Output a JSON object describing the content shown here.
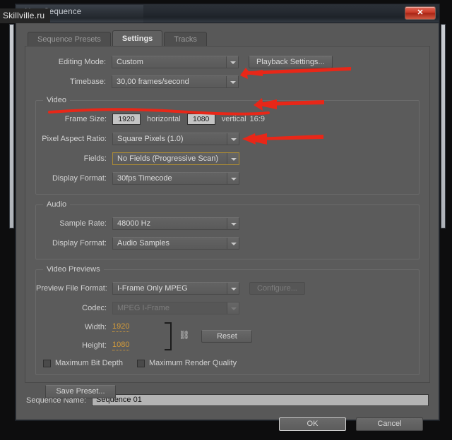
{
  "window": {
    "title": "New Sequence",
    "close_label": "✕"
  },
  "watermark": {
    "text": "Skillville.ru"
  },
  "tabs": [
    {
      "label": "Sequence Presets",
      "active": false
    },
    {
      "label": "Settings",
      "active": true
    },
    {
      "label": "Tracks",
      "active": false
    }
  ],
  "top": {
    "editing_mode_label": "Editing Mode:",
    "editing_mode_value": "Custom",
    "playback_settings_label": "Playback Settings...",
    "timebase_label": "Timebase:",
    "timebase_value": "30,00 frames/second"
  },
  "video": {
    "group_title": "Video",
    "frame_size_label": "Frame Size:",
    "frame_width": "1920",
    "horizontal_label": "horizontal",
    "frame_height": "1080",
    "vertical_label": "vertical",
    "aspect_ratio_text": "16:9",
    "pixel_aspect_label": "Pixel Aspect Ratio:",
    "pixel_aspect_value": "Square Pixels (1.0)",
    "fields_label": "Fields:",
    "fields_value": "No Fields (Progressive Scan)",
    "display_format_label": "Display Format:",
    "display_format_value": "30fps Timecode"
  },
  "audio": {
    "group_title": "Audio",
    "sample_rate_label": "Sample Rate:",
    "sample_rate_value": "48000 Hz",
    "display_format_label": "Display Format:",
    "display_format_value": "Audio Samples"
  },
  "video_previews": {
    "group_title": "Video Previews",
    "preview_file_format_label": "Preview File Format:",
    "preview_file_format_value": "I-Frame Only MPEG",
    "configure_label": "Configure...",
    "codec_label": "Codec:",
    "codec_value": "MPEG I-Frame",
    "width_label": "Width:",
    "width_value": "1920",
    "height_label": "Height:",
    "height_value": "1080",
    "link_icon": "⛓",
    "reset_label": "Reset",
    "max_bit_depth_label": "Maximum Bit Depth",
    "max_render_quality_label": "Maximum Render Quality"
  },
  "footer": {
    "save_preset_label": "Save Preset...",
    "sequence_name_label": "Sequence Name:",
    "sequence_name_value": "Sequence 01",
    "ok_label": "OK",
    "cancel_label": "Cancel"
  },
  "annotations": {
    "color": "#e82718",
    "items": [
      {
        "name": "arrow-timebase"
      },
      {
        "name": "arrow-frame-size"
      },
      {
        "name": "underline-frame-size"
      },
      {
        "name": "arrow-fields"
      }
    ]
  }
}
